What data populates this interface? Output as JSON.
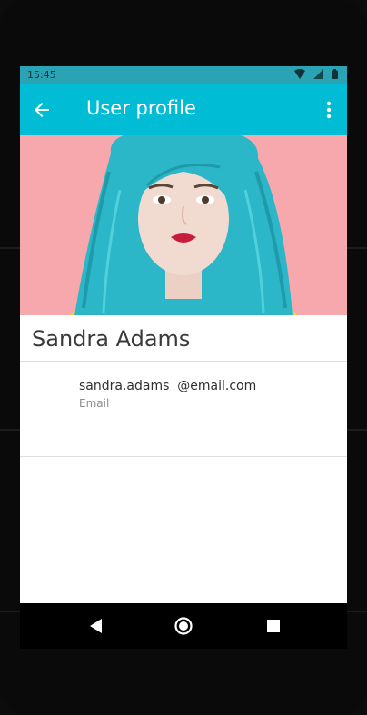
{
  "status_bar": {
    "time": "15:45",
    "icons": [
      "wifi-icon",
      "signal-icon",
      "battery-icon"
    ]
  },
  "app_bar": {
    "title": "User profile",
    "back_icon": "arrow-back-icon",
    "menu_icon": "more-vert-icon",
    "color": "#00bcd4"
  },
  "profile": {
    "name": "Sandra Adams",
    "email": "sandra.adams  @email.com",
    "email_label": "Email"
  },
  "navigation": {
    "buttons": [
      "back-triangle-icon",
      "home-circle-icon",
      "recents-square-icon"
    ]
  },
  "colors": {
    "hero_background": "#f7a8ad",
    "hair": "#2bb7c7"
  }
}
